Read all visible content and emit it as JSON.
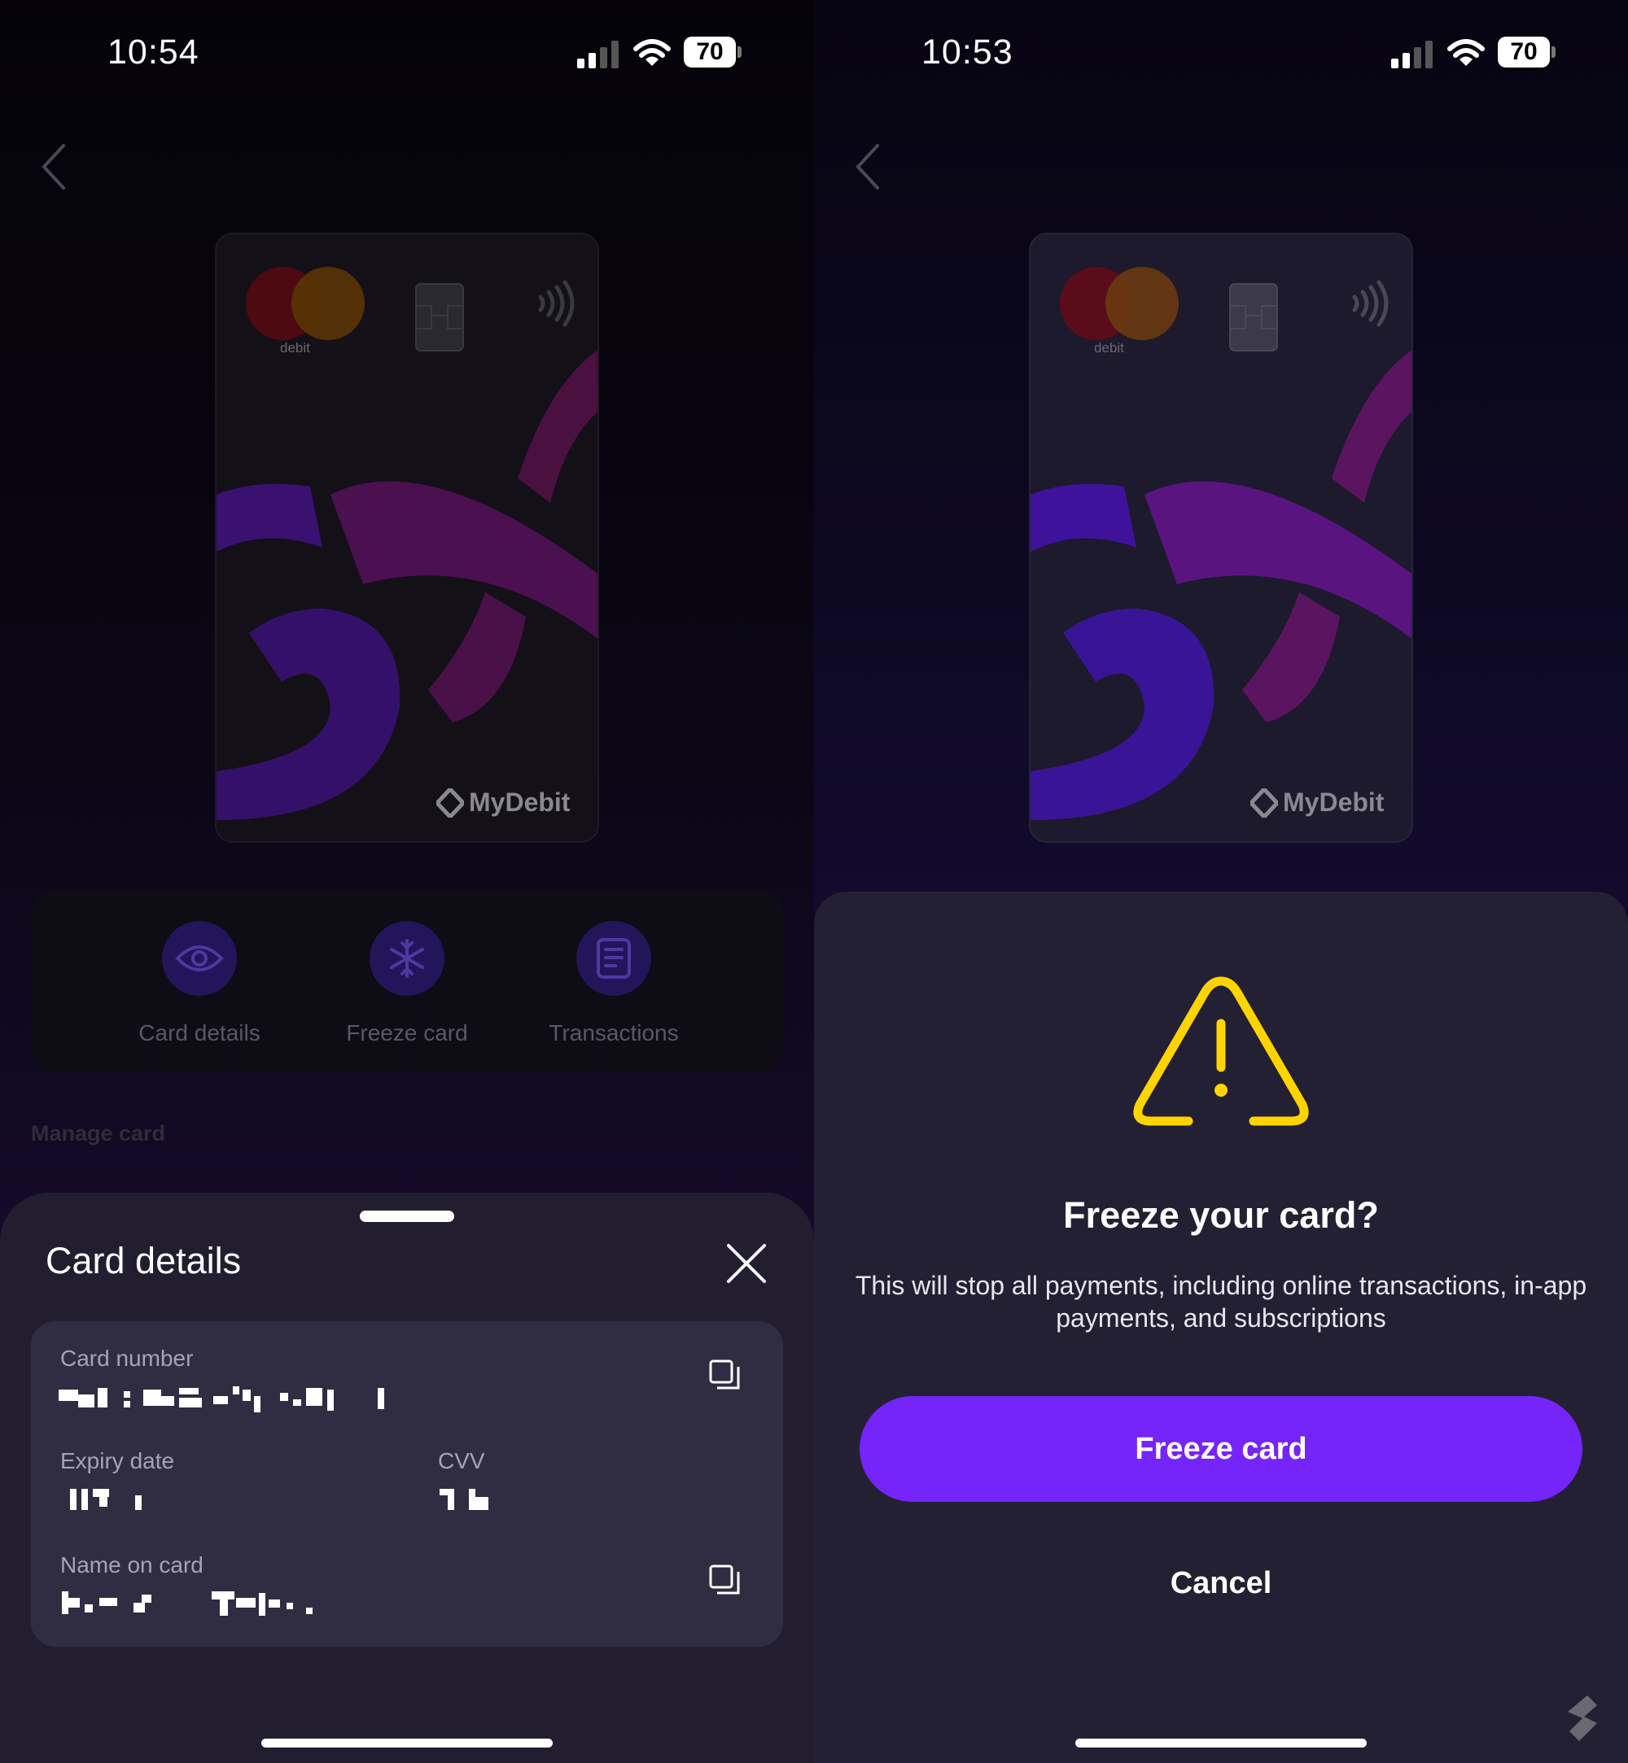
{
  "left_screen": {
    "status": {
      "time": "10:54",
      "battery": "70"
    },
    "card": {
      "network_label": "debit",
      "brand": "MyDebit"
    },
    "actions": [
      {
        "label": "Card details",
        "icon": "eye-icon"
      },
      {
        "label": "Freeze card",
        "icon": "snowflake-icon"
      },
      {
        "label": "Transactions",
        "icon": "receipt-icon"
      }
    ],
    "section_label": "Manage card",
    "sheet": {
      "title": "Card details",
      "card_number_label": "Card number",
      "expiry_label": "Expiry date",
      "cvv_label": "CVV",
      "name_label": "Name on card"
    }
  },
  "right_screen": {
    "status": {
      "time": "10:53",
      "battery": "70"
    },
    "card": {
      "network_label": "debit",
      "brand": "MyDebit"
    },
    "modal": {
      "title": "Freeze your card?",
      "message": "This will stop all payments, including online transactions, in-app payments, and subscriptions",
      "confirm_label": "Freeze card",
      "cancel_label": "Cancel"
    }
  },
  "colors": {
    "accent": "#7524fa",
    "warning": "#ffd400",
    "sheet_background": "#221e30"
  }
}
